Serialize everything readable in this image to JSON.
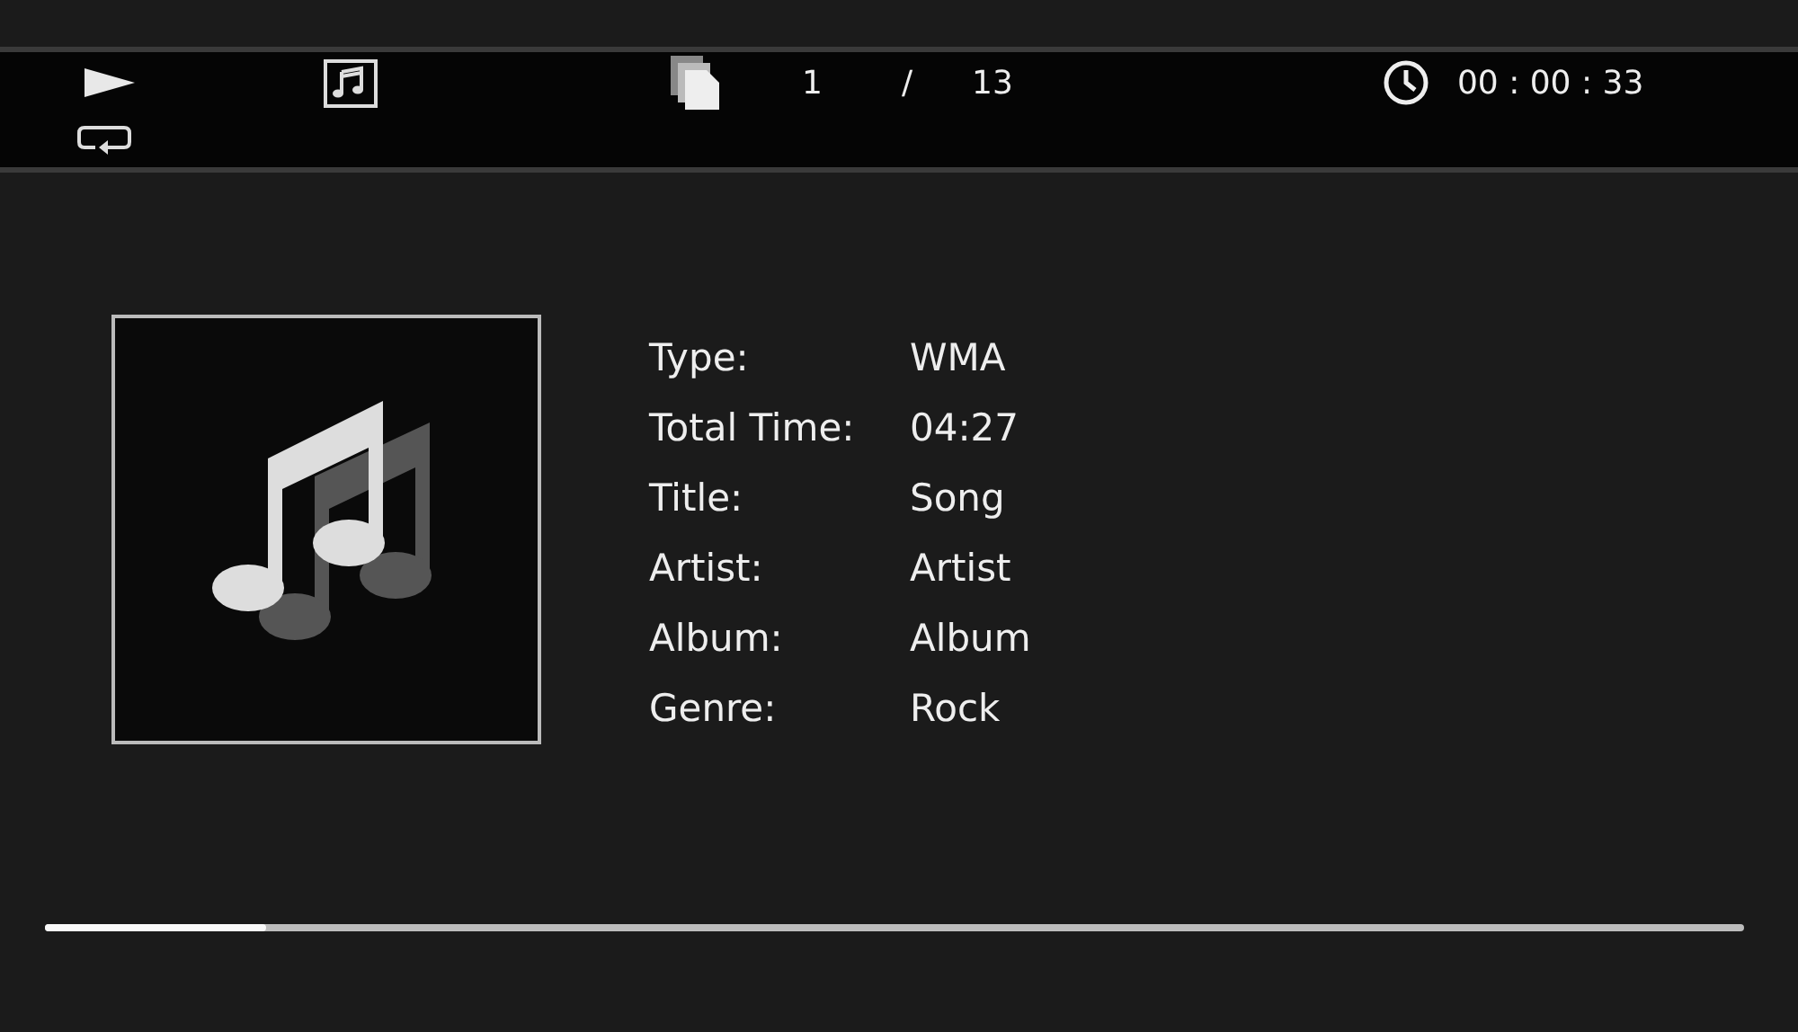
{
  "status_bar": {
    "track_index": "1",
    "separator": "/",
    "track_total": "13",
    "elapsed": "00 : 00 : 33"
  },
  "details": [
    {
      "label": "Type:",
      "value": "WMA"
    },
    {
      "label": "Total Time:",
      "value": "04:27"
    },
    {
      "label": "Title:",
      "value": "Song"
    },
    {
      "label": "Artist:",
      "value": "Artist"
    },
    {
      "label": "Album:",
      "value": "Album"
    },
    {
      "label": "Genre:",
      "value": "Rock"
    }
  ],
  "progress": {
    "level": 0.13
  }
}
